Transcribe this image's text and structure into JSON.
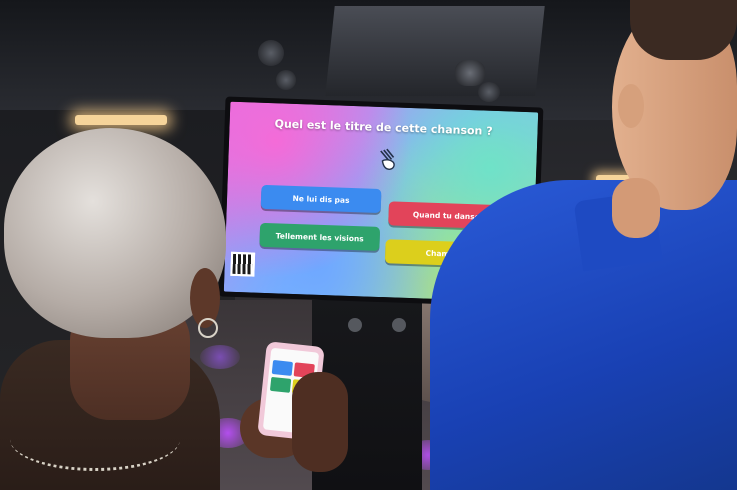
{
  "scene": {
    "description_hidden": false,
    "tv": {
      "question": "Quel est le titre de cette chanson ?",
      "answers": [
        "Ne lui dis pas",
        "Quand tu danses",
        "Tellement les visions",
        "Chamade"
      ],
      "answer_colors": [
        "#3b8bf0",
        "#e2445a",
        "#2ea36c",
        "#dccf1c"
      ]
    },
    "icons": [
      "hand-pointer-icon",
      "qr-code-icon"
    ]
  }
}
